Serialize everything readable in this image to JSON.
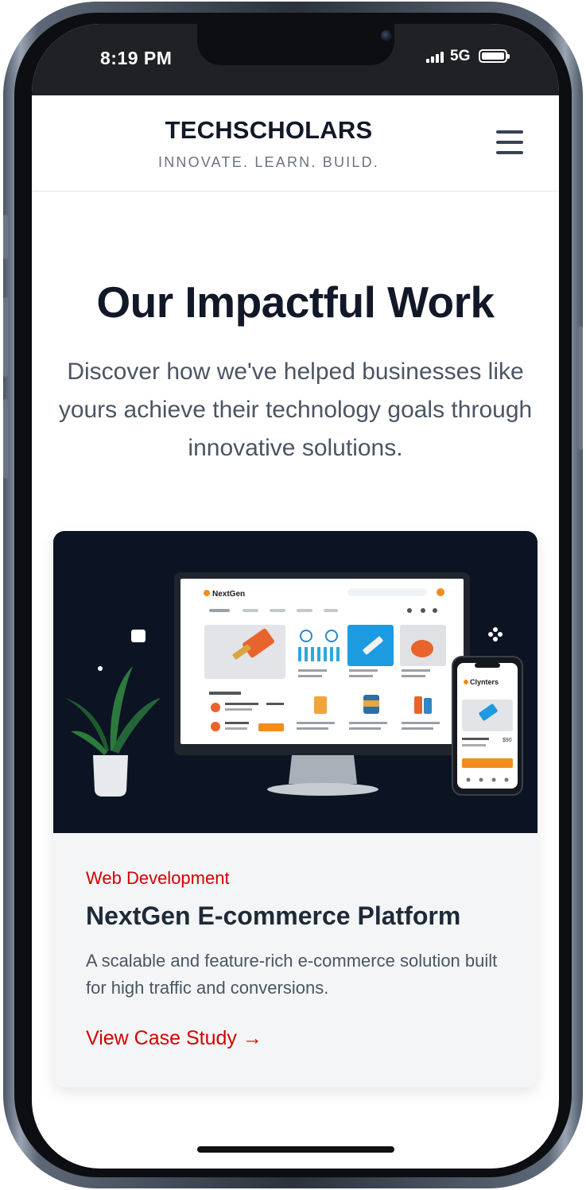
{
  "status_bar": {
    "time": "8:19 PM",
    "network": "5G"
  },
  "header": {
    "brand": "TECHSCHOLARS",
    "tagline": "INNOVATE. LEARN. BUILD.",
    "menu_icon": "hamburger-menu-icon"
  },
  "hero": {
    "title": "Our Impactful Work",
    "subtitle": "Discover how we've helped businesses like yours achieve their technology goals through innovative solutions."
  },
  "card": {
    "category": "Web Development",
    "title": "NextGen E-commerce Platform",
    "description": "A scalable and feature-rich e-commerce solution built for high traffic and conversions.",
    "link": "View Case Study →",
    "mockup": {
      "desktop_logo": "NextGen",
      "phone_logo": "Clynters",
      "phone_price": "$90"
    }
  },
  "colors": {
    "accent": "#d40000",
    "text_dark": "#111827",
    "image_bg": "#0c1424",
    "mock_orange": "#f28c1c"
  }
}
